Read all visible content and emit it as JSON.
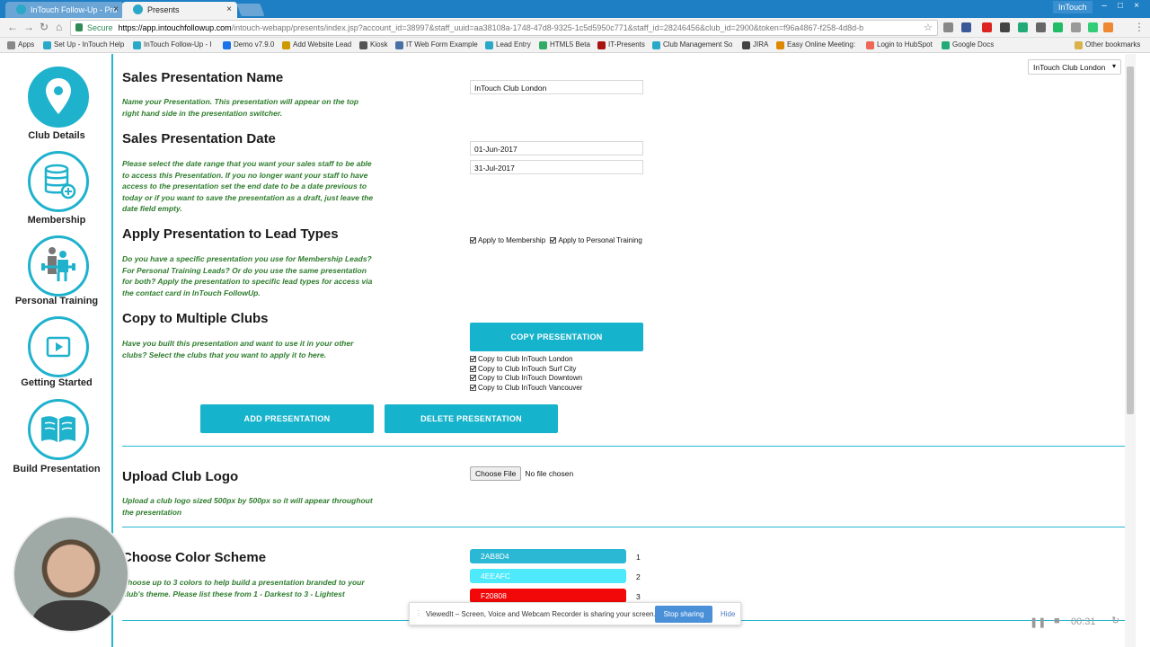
{
  "browser": {
    "tabs": [
      {
        "title": "InTouch Follow-Up - Pro"
      },
      {
        "title": "Presents"
      }
    ],
    "profile": "InTouch",
    "url": {
      "secure_label": "Secure",
      "host": "https://app.intouchfollowup.com",
      "path": "/intouch-webapp/presents/index.jsp?account_id=38997&staff_uuid=aa38108a-1748-47d8-9325-1c5d5950c771&staff_id=28246456&club_id=2900&token=f96a4867-f258-4d8d-b"
    },
    "bookmarks": [
      {
        "label": "Apps"
      },
      {
        "label": "Set Up - InTouch Help"
      },
      {
        "label": "InTouch Follow-Up - I"
      },
      {
        "label": "Demo v7.9.0"
      },
      {
        "label": "Add Website Lead"
      },
      {
        "label": "Kiosk"
      },
      {
        "label": "IT Web Form Example"
      },
      {
        "label": "Lead Entry"
      },
      {
        "label": "HTML5 Beta"
      },
      {
        "label": "IT-Presents"
      },
      {
        "label": "Club Management So"
      },
      {
        "label": "JIRA"
      },
      {
        "label": "Easy Online Meeting:"
      },
      {
        "label": "Login to HubSpot"
      },
      {
        "label": "Google Docs"
      },
      {
        "label": "Other bookmarks"
      }
    ]
  },
  "sidebar": {
    "items": [
      {
        "label": "Club Details",
        "icon": "map-pin-icon"
      },
      {
        "label": "Membership",
        "icon": "database-add-icon"
      },
      {
        "label": "Personal Training",
        "icon": "trainer-icon"
      },
      {
        "label": "Getting Started",
        "icon": "play-icon"
      },
      {
        "label": "Build Presentation",
        "icon": "book-icon"
      }
    ]
  },
  "header": {
    "club_select": "InTouch Club London"
  },
  "form": {
    "name": {
      "title": "Sales Presentation Name",
      "help": "Name your Presentation. This presentation will appear on the top right hand side in the presentation switcher.",
      "value": "InTouch Club London"
    },
    "date": {
      "title": "Sales Presentation Date",
      "help": "Please select the date range that you want your sales staff to be able to access this Presentation. If you no longer want your staff to have access to the presentation set the end date to be a date previous to today or if you want to save the presentation as a draft, just leave the date field empty.",
      "start": "01-Jun-2017",
      "end": "31-Jul-2017"
    },
    "lead_types": {
      "title": "Apply Presentation to Lead Types",
      "help": "Do you have a specific presentation you use for Membership Leads? For Personal Training Leads? Or do you use the same presentation for both? Apply the presentation to specific lead types for access via the contact card in InTouch FollowUp.",
      "membership_label": "Apply to Membership",
      "pt_label": "Apply to Personal Training"
    },
    "copy": {
      "title": "Copy to Multiple Clubs",
      "help": "Have you built this presentation and want to use it in your other clubs? Select the clubs that you want to apply it to here.",
      "button": "COPY PRESENTATION",
      "clubs": [
        "Copy to Club InTouch London",
        "Copy to Club InTouch Surf City",
        "Copy to Club InTouch Downtown",
        "Copy to Club InTouch Vancouver"
      ]
    },
    "actions": {
      "add": "ADD PRESENTATION",
      "delete": "DELETE PRESENTATION"
    },
    "logo": {
      "title": "Upload Club Logo",
      "help": "Upload a club logo sized 500px by 500px so it will appear throughout the presentation",
      "file_button": "Choose File",
      "file_status": "No file chosen"
    },
    "colors": {
      "title": "Choose Color Scheme",
      "help": "Choose up to 3 colors to help build a presentation branded to your club's theme. Please list these from 1 - Darkest to 3 - Lightest",
      "swatches": [
        {
          "hex": "2AB8D4",
          "num": "1",
          "color": "#2AB8D4"
        },
        {
          "hex": "4EEAFC",
          "num": "2",
          "color": "#4EEAFC"
        },
        {
          "hex": "F20808",
          "num": "3",
          "color": "#F20808"
        }
      ]
    }
  },
  "sharing_bar": {
    "text": "ViewedIt – Screen, Voice and Webcam Recorder is sharing your screen.",
    "stop": "Stop sharing",
    "hide": "Hide"
  },
  "recorder": {
    "time": "00:31"
  },
  "colors": {
    "accent": "#16b3cc",
    "help_text": "#2e7d2e"
  }
}
